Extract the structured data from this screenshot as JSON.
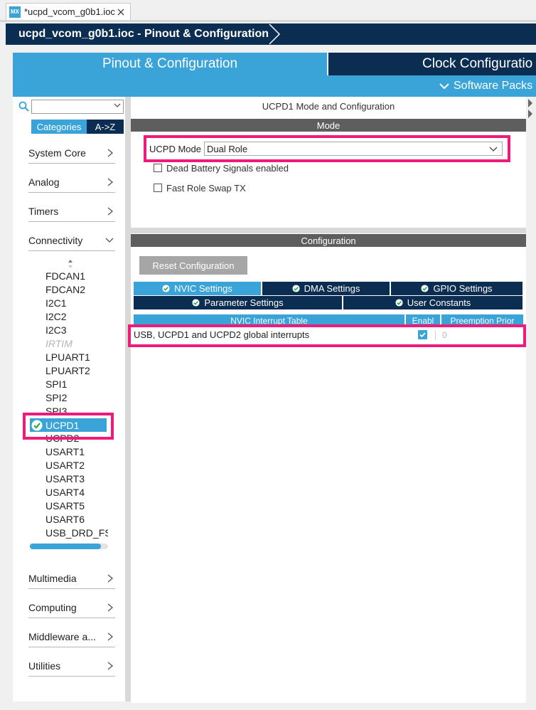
{
  "editor_tab": {
    "badge": "MX",
    "title": "*ucpd_vcom_g0b1.ioc"
  },
  "breadcrumb": {
    "item": "ucpd_vcom_g0b1.ioc - Pinout & Configuration"
  },
  "main_tabs": [
    {
      "label": "Pinout & Configuration",
      "active": true
    },
    {
      "label": "Clock Configuratio",
      "active": false
    }
  ],
  "software_packs": "Software Packs",
  "sidebar": {
    "search": {
      "value": "",
      "placeholder": ""
    },
    "sort_tabs": [
      "Categories",
      "A->Z"
    ],
    "categories": [
      {
        "label": "System Core",
        "expanded": false
      },
      {
        "label": "Analog",
        "expanded": false
      },
      {
        "label": "Timers",
        "expanded": false
      },
      {
        "label": "Connectivity",
        "expanded": true
      },
      {
        "label": "Multimedia",
        "expanded": false
      },
      {
        "label": "Computing",
        "expanded": false
      },
      {
        "label": "Middleware a...",
        "expanded": false
      },
      {
        "label": "Utilities",
        "expanded": false
      }
    ],
    "peripherals": [
      {
        "label": "FDCAN1",
        "state": "normal"
      },
      {
        "label": "FDCAN2",
        "state": "normal"
      },
      {
        "label": "I2C1",
        "state": "normal"
      },
      {
        "label": "I2C2",
        "state": "normal"
      },
      {
        "label": "I2C3",
        "state": "normal"
      },
      {
        "label": "IRTIM",
        "state": "disabled"
      },
      {
        "label": "LPUART1",
        "state": "normal"
      },
      {
        "label": "LPUART2",
        "state": "normal"
      },
      {
        "label": "SPI1",
        "state": "normal"
      },
      {
        "label": "SPI2",
        "state": "normal"
      },
      {
        "label": "SPI3",
        "state": "normal"
      },
      {
        "label": "UCPD1",
        "state": "selected"
      },
      {
        "label": "UCPD2",
        "state": "normal"
      },
      {
        "label": "USART1",
        "state": "normal"
      },
      {
        "label": "USART2",
        "state": "normal"
      },
      {
        "label": "USART3",
        "state": "normal"
      },
      {
        "label": "USART4",
        "state": "normal"
      },
      {
        "label": "USART5",
        "state": "normal"
      },
      {
        "label": "USART6",
        "state": "normal"
      },
      {
        "label": "USB_DRD_FS",
        "state": "normal"
      }
    ]
  },
  "mode_panel": {
    "title": "UCPD1 Mode and Configuration",
    "section": "Mode",
    "mode_label": "UCPD Mode",
    "mode_value": "Dual Role",
    "checkboxes": [
      {
        "label": "Dead Battery Signals enabled",
        "checked": false
      },
      {
        "label": "Fast Role Swap TX",
        "checked": false
      }
    ]
  },
  "config_panel": {
    "section": "Configuration",
    "reset_button": "Reset Configuration",
    "tabs_row1": [
      {
        "label": "NVIC Settings",
        "active": true
      },
      {
        "label": "DMA Settings",
        "active": false
      },
      {
        "label": "GPIO Settings",
        "active": false
      }
    ],
    "tabs_row2": [
      {
        "label": "Parameter Settings",
        "active": false
      },
      {
        "label": "User Constants",
        "active": false
      }
    ],
    "table": {
      "columns": [
        "NVIC Interrupt Table",
        "Enabl",
        "Preemption Prior"
      ],
      "rows": [
        {
          "name": "USB, UCPD1 and UCPD2 global interrupts",
          "enabled": true,
          "priority": "0"
        }
      ]
    }
  },
  "colors": {
    "accent": "#3aa3d8",
    "navy": "#0c2d52",
    "highlight": "#ee1b7a",
    "section_gray": "#5e5e5e"
  }
}
